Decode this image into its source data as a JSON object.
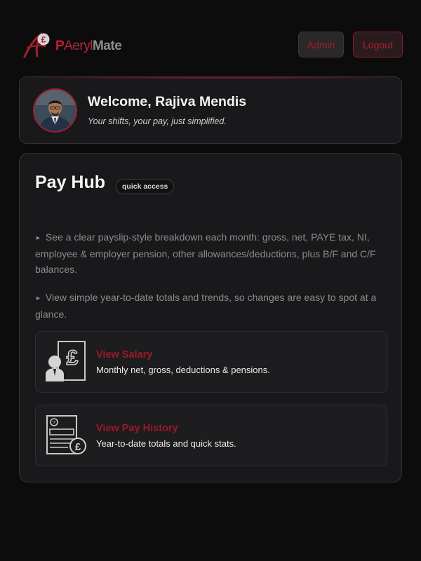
{
  "header": {
    "logo": {
      "p": "P",
      "mid": "Aeryl",
      "mate": "Mate"
    },
    "admin_label": "Admin",
    "logout_label": "Logout"
  },
  "welcome": {
    "title": "Welcome, Rajiva Mendis",
    "subtitle": "Your shifts, your pay, just simplified."
  },
  "hub": {
    "title": "Pay Hub",
    "badge": "quick access",
    "bullets": [
      {
        "mark": "►",
        "text": "See a clear payslip-style breakdown each month: gross, net, PAYE tax, NI, employee & employer pension, other allowances/deductions, plus B/F and C/F balances."
      },
      {
        "mark": "►",
        "text": "View simple year-to-date totals and trends, so changes are easy to spot at a glance."
      }
    ],
    "links": [
      {
        "title": "View Salary",
        "desc": "Monthly net, gross, deductions & pensions.",
        "icon": "salary-icon"
      },
      {
        "title": "View Pay History",
        "desc": "Year-to-date totals and quick stats.",
        "icon": "pay-history-icon"
      }
    ]
  },
  "colors": {
    "accent": "#a61d2b",
    "background": "#0d0c0d",
    "card": "#19181a"
  }
}
